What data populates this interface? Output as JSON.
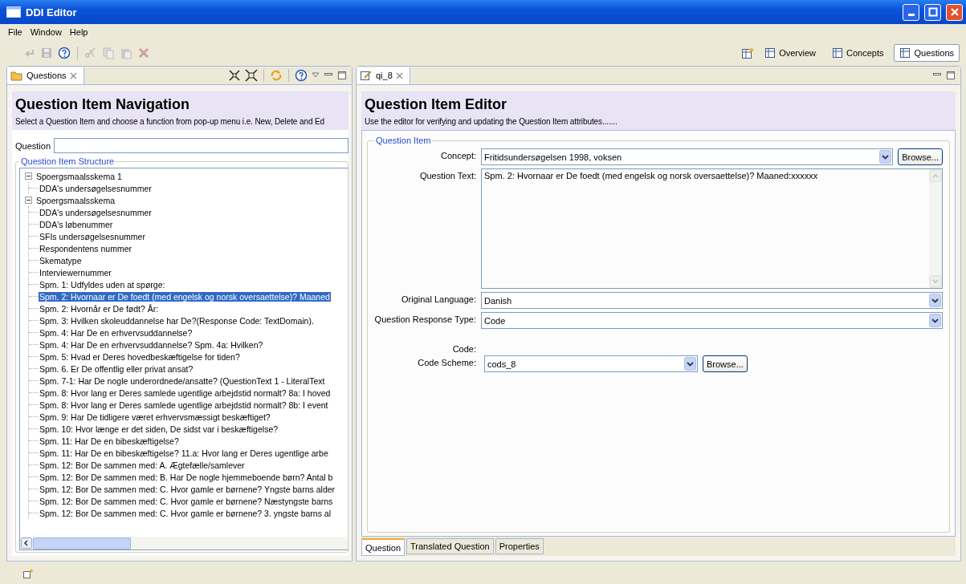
{
  "window": {
    "title": "DDI Editor"
  },
  "menu": [
    "File",
    "Window",
    "Help"
  ],
  "perspectives": [
    {
      "label": "Overview",
      "selected": false
    },
    {
      "label": "Concepts",
      "selected": false
    },
    {
      "label": "Questions",
      "selected": true
    }
  ],
  "navigator": {
    "tab": "Questions",
    "title": "Question Item Navigation",
    "description": "Select a Question Item and choose a function from pop-up menu i.e. New, Delete and Ed",
    "search_label": "Question",
    "group_label": "Question Item Structure",
    "tree": [
      {
        "label": "Spoergsmaalsskema 1",
        "expanded": true,
        "selected": false,
        "children": [
          {
            "label": "DDA's undersøgelsesnummer",
            "selected": false
          }
        ]
      },
      {
        "label": "Spoergsmaalsskema",
        "expanded": true,
        "selected": false,
        "children": [
          {
            "label": "DDA's undersøgelsesnummer",
            "selected": false
          },
          {
            "label": "DDA's løbenummer",
            "selected": false
          },
          {
            "label": "SFIs undersøgelsesnummer",
            "selected": false
          },
          {
            "label": "Respondentens nummer",
            "selected": false
          },
          {
            "label": "Skematype",
            "selected": false
          },
          {
            "label": "Interviewernummer",
            "selected": false
          },
          {
            "label": "Spm. 1: Udfyldes uden at spørge:",
            "selected": false
          },
          {
            "label": "Spm. 2: Hvornaar er De foedt (med engelsk og norsk oversaettelse)? Maaned",
            "selected": true
          },
          {
            "label": "Spm. 2: Hvornår er De født? År:",
            "selected": false
          },
          {
            "label": "Spm. 3: Hvilken skoleuddannelse har De?(Response Code: TextDomain).",
            "selected": false
          },
          {
            "label": "Spm. 4: Har De en erhvervsuddannelse?",
            "selected": false
          },
          {
            "label": "Spm. 4: Har De en erhvervsuddannelse? Spm. 4a: Hvilken?",
            "selected": false
          },
          {
            "label": "Spm. 5: Hvad er Deres hovedbeskæftigelse for tiden?",
            "selected": false
          },
          {
            "label": "Spm. 6. Er De offentlig eller privat ansat?",
            "selected": false
          },
          {
            "label": "Spm. 7-1: Har De nogle underordnede/ansatte? (QuestionText 1 - LiteralText",
            "selected": false
          },
          {
            "label": "Spm. 8: Hvor lang er Deres samlede ugentlige arbejdstid normalt? 8a: I hoved",
            "selected": false
          },
          {
            "label": "Spm. 8: Hvor lang er Deres samlede ugentlige arbejdstid normalt? 8b: I event",
            "selected": false
          },
          {
            "label": "Spm. 9: Har De tidligere været erhvervsmæssigt beskæftiget?",
            "selected": false
          },
          {
            "label": "Spm. 10: Hvor længe er det siden, De sidst var i beskæftigelse?",
            "selected": false
          },
          {
            "label": "Spm. 11: Har De en bibeskæftigelse?",
            "selected": false
          },
          {
            "label": "Spm. 11: Har De en bibeskæftigelse? 11.a: Hvor lang er Deres ugentlige arbe",
            "selected": false
          },
          {
            "label": "Spm. 12: Bor De sammen med: A. Ægtefælle/samlever",
            "selected": false
          },
          {
            "label": "Spm. 12: Bor De sammen med: B. Har De nogle hjemmeboende børn? Antal b",
            "selected": false
          },
          {
            "label": "Spm. 12: Bor De sammen med: C. Hvor gamle er børnene? Yngste barns alder",
            "selected": false
          },
          {
            "label": "Spm. 12: Bor De sammen med: C. Hvor gamle er børnene? Næstyngste barns",
            "selected": false
          },
          {
            "label": "Spm. 12: Bor De sammen med: C. Hvor gamle er børnene? 3. yngste barns al",
            "selected": false
          }
        ]
      }
    ]
  },
  "editor": {
    "tab": "qi_8",
    "title": "Question Item Editor",
    "description": "Use the editor for verifying and updating the Question Item attributes.......",
    "group_label": "Question Item",
    "fields": [
      {
        "kind": "combo",
        "label": "Concept:",
        "value": "Fritidsundersøgelsen 1998, voksen",
        "button": "Browse..."
      },
      {
        "kind": "textarea",
        "label": "Question Text:",
        "value": "Spm. 2: Hvornaar er De foedt (med engelsk og norsk oversaettelse)? Maaned:xxxxxx"
      },
      {
        "kind": "combo",
        "label": "Original Language:",
        "value": "Danish"
      },
      {
        "kind": "combo",
        "label": "Question Response Type:",
        "value": "Code"
      },
      {
        "kind": "heading",
        "label": "Code:"
      },
      {
        "kind": "compact_combo",
        "label": "Code Scheme:",
        "value": "cods_8",
        "button": "Browse..."
      }
    ],
    "tabs": [
      {
        "label": "Question",
        "selected": true
      },
      {
        "label": "Translated Question",
        "selected": false
      },
      {
        "label": "Properties",
        "selected": false
      }
    ]
  }
}
